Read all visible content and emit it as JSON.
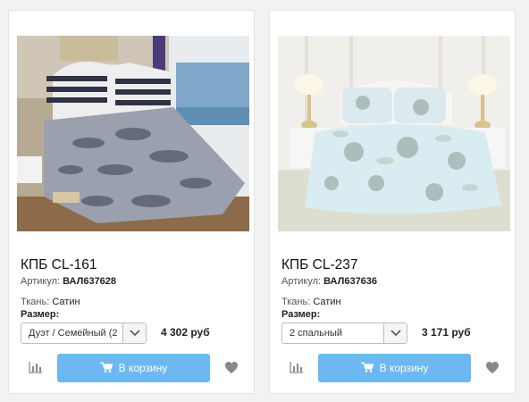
{
  "products": [
    {
      "title": "КПБ CL-161",
      "sku_label": "Артикул:",
      "sku": "ВАЛ637628",
      "fabric_label": "Ткань:",
      "fabric": "Сатин",
      "size_label": "Размер:",
      "size_selected": "Дуэт / Семейный (2",
      "price": "4 302 руб",
      "cart_label": "В корзину"
    },
    {
      "title": "КПБ CL-237",
      "sku_label": "Артикул:",
      "sku": "ВАЛ637636",
      "fabric_label": "Ткань:",
      "fabric": "Сатин",
      "size_label": "Размер:",
      "size_selected": "2 спальный",
      "price": "3 171 руб",
      "cart_label": "В корзину"
    }
  ],
  "icons": {
    "stats": "bar-chart-icon",
    "cart": "cart-icon",
    "favorite": "heart-icon",
    "dropdown": "chevron-down-icon"
  },
  "colors": {
    "cart_button": "#6db8f2",
    "icon_gray": "#888888"
  }
}
